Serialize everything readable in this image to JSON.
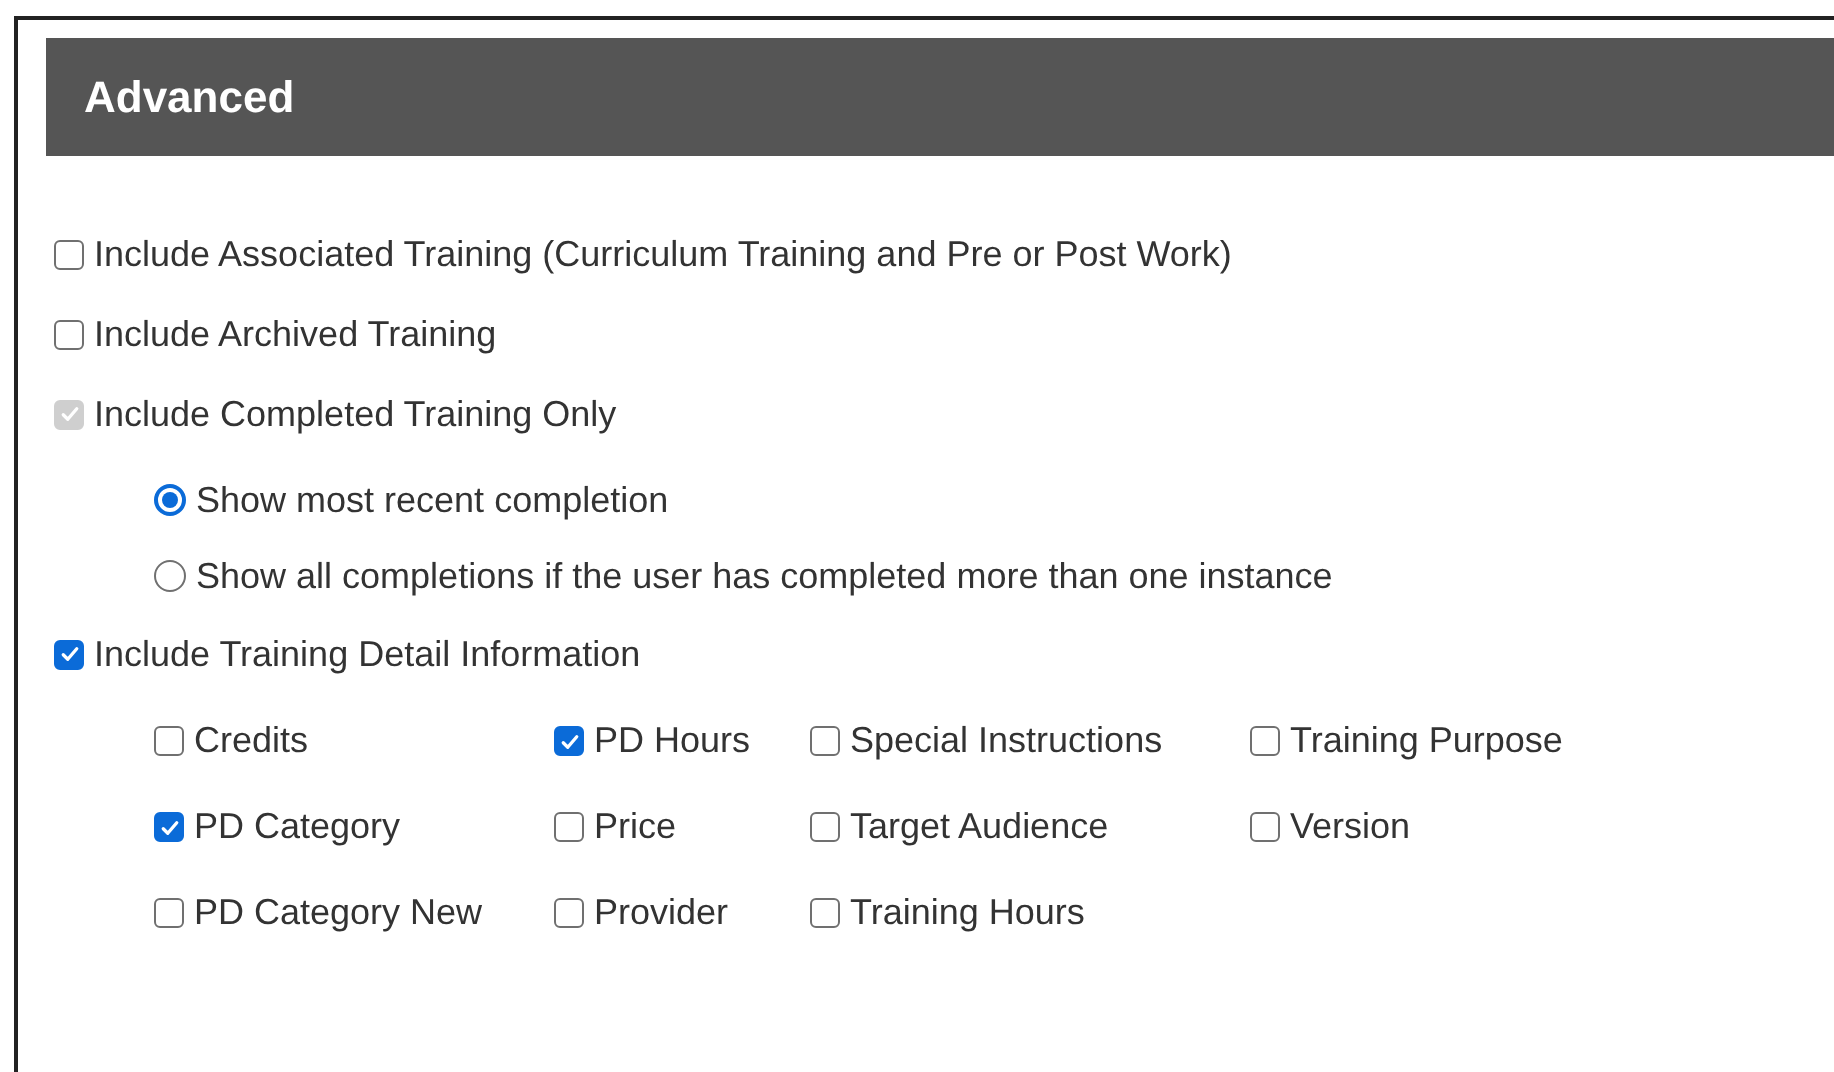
{
  "section": {
    "title": "Advanced"
  },
  "options": [
    {
      "kind": "checkbox",
      "label": "Include Associated Training (Curriculum Training and Pre or Post Work)",
      "checked": false,
      "disabled": false
    },
    {
      "kind": "checkbox",
      "label": "Include Archived Training",
      "checked": false,
      "disabled": false
    },
    {
      "kind": "checkbox",
      "label": "Include Completed Training Only",
      "checked": true,
      "disabled": true
    },
    {
      "kind": "radio",
      "label": "Show most recent completion",
      "selected": true
    },
    {
      "kind": "radio",
      "label": "Show all completions if the user has completed more than one instance",
      "selected": false
    },
    {
      "kind": "checkbox",
      "label": "Include Training Detail Information",
      "checked": true,
      "disabled": false
    }
  ],
  "detail_fields": [
    {
      "label": "Credits",
      "checked": false
    },
    {
      "label": "PD Hours",
      "checked": true
    },
    {
      "label": "Special Instructions",
      "checked": false
    },
    {
      "label": "Training Purpose",
      "checked": false
    },
    {
      "label": "PD Category",
      "checked": true
    },
    {
      "label": "Price",
      "checked": false
    },
    {
      "label": "Target Audience",
      "checked": false
    },
    {
      "label": "Version",
      "checked": false
    },
    {
      "label": "PD Category New",
      "checked": false
    },
    {
      "label": "Provider",
      "checked": false
    },
    {
      "label": "Training Hours",
      "checked": false
    }
  ]
}
